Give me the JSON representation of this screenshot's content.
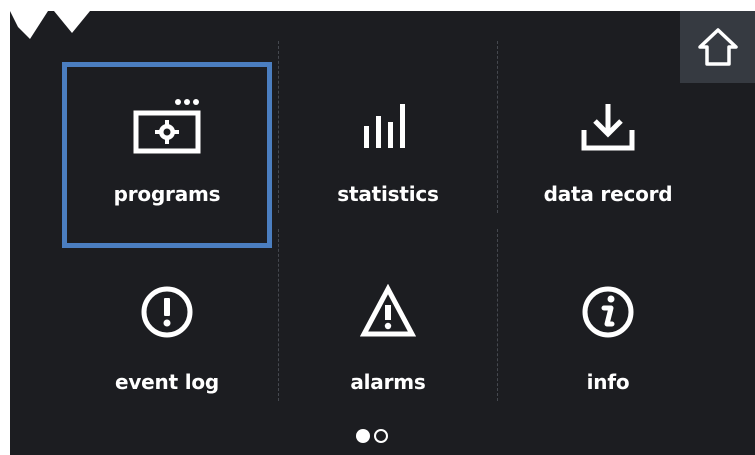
{
  "header": {
    "home_icon": "home-icon"
  },
  "menu": {
    "tiles": [
      {
        "label": "programs",
        "icon": "programs-gear-icon",
        "selected": true
      },
      {
        "label": "statistics",
        "icon": "bar-chart-icon",
        "selected": false
      },
      {
        "label": "data record",
        "icon": "download-icon",
        "selected": false
      },
      {
        "label": "event log",
        "icon": "exclamation-circle-icon",
        "selected": false
      },
      {
        "label": "alarms",
        "icon": "warning-triangle-icon",
        "selected": false
      },
      {
        "label": "info",
        "icon": "info-circle-icon",
        "selected": false
      }
    ]
  },
  "pagination": {
    "current_page": 1,
    "total_pages": 2
  },
  "colors": {
    "background": "#1c1d21",
    "home_button": "#363a41",
    "selection": "#4b7ec0",
    "text": "#ffffff"
  }
}
